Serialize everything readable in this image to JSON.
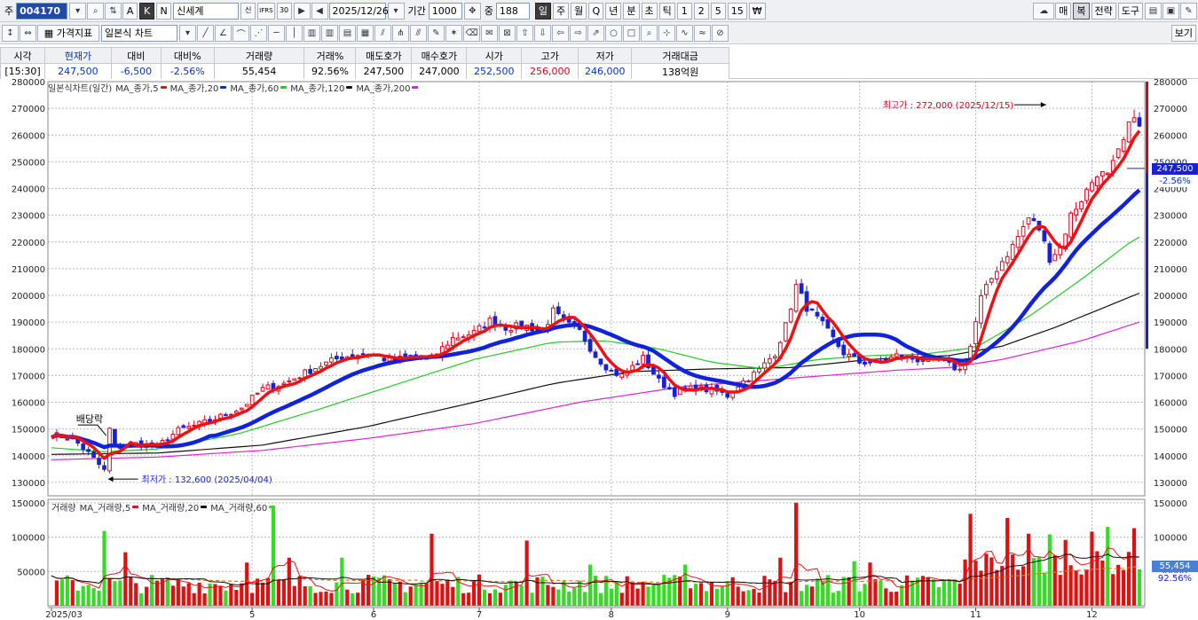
{
  "toolbar1": {
    "market_label": "주",
    "code": "004170",
    "btn_k_upper": "A",
    "btn_k": "K",
    "btn_n": "N",
    "stock_name": "신세계",
    "name_badges": [
      "신",
      "IFRS",
      "30"
    ],
    "date": "2025/12/26",
    "period_label": "기간",
    "period_value": "1000",
    "count_label": "중",
    "count_value": "188",
    "periods": [
      "일",
      "주",
      "월",
      "Q",
      "년",
      "분",
      "초",
      "틱",
      "1",
      "2",
      "5",
      "15",
      "₩"
    ],
    "active_period": "일",
    "right_buttons": [
      "매",
      "복",
      "전략",
      "도구"
    ]
  },
  "toolbar2": {
    "indicator_button": "가격지표",
    "chart_type": "일본식 차트",
    "view_button": "보기"
  },
  "quote": {
    "headers": [
      "시각",
      "현재가",
      "대비",
      "대비%",
      "거래량",
      "거래%",
      "매도호가",
      "매수호가",
      "시가",
      "고가",
      "저가",
      "거래대금"
    ],
    "values": [
      "[15:30]",
      "247,500",
      "-6,500",
      "-2.56%",
      "55,454",
      "92.56%",
      "247,500",
      "247,000",
      "252,500",
      "256,000",
      "246,000",
      "138억원"
    ]
  },
  "colors": {
    "up": "#e8001c",
    "down": "#1a20d8",
    "ma5": "#ee1111",
    "ma20": "#1122dd",
    "ma60": "#22cc22",
    "ma120": "#111111",
    "ma200": "#dd22dd",
    "vol_up": "#dd1111",
    "vol_down": "#33dd22"
  },
  "chart_data": [
    {
      "type": "candlestick",
      "title": "일본식차트(일간)",
      "legend": [
        "MA_종가,5",
        "MA_종가,20",
        "MA_종가,60",
        "MA_종가,120",
        "MA_종가,200"
      ],
      "ylim": [
        125000,
        280000
      ],
      "y_ticks": [
        130000,
        140000,
        150000,
        160000,
        170000,
        180000,
        190000,
        200000,
        210000,
        220000,
        230000,
        240000,
        250000,
        260000,
        270000,
        280000
      ],
      "y_tick_labels": [
        "130000",
        "140000",
        "150000",
        "160000",
        "170000",
        "180000",
        "190000",
        "200000",
        "210000",
        "220000",
        "230000",
        "240000",
        "250000",
        "260000",
        "270000",
        "280000"
      ],
      "x_labels": [
        "2025/03",
        "5",
        "6",
        "7",
        "8",
        "9",
        "10",
        "11",
        "12"
      ],
      "x_label_days": [
        0,
        38,
        61,
        81,
        106,
        128,
        153,
        175,
        197
      ],
      "total_days": 206,
      "annotations": {
        "high": {
          "text": "최고가 : 272,000 (2025/12/15)",
          "value": 272000,
          "day": 189
        },
        "low": {
          "text": "최저가 : 132,600 (2025/04/04)",
          "value": 132600,
          "day": 10
        },
        "dividend": {
          "text": "배당락",
          "day": 5
        }
      },
      "last_price": {
        "value": 247500,
        "label": "247,500",
        "pct": "-2.56%"
      },
      "anchors": [
        [
          0,
          148000
        ],
        [
          4,
          146500
        ],
        [
          7,
          141000
        ],
        [
          10,
          134500
        ],
        [
          11,
          150000
        ],
        [
          12,
          143000
        ],
        [
          16,
          144500
        ],
        [
          20,
          143500
        ],
        [
          24,
          149500
        ],
        [
          30,
          153000
        ],
        [
          36,
          158000
        ],
        [
          40,
          165000
        ],
        [
          44,
          167000
        ],
        [
          50,
          173000
        ],
        [
          55,
          177000
        ],
        [
          60,
          178500
        ],
        [
          64,
          175500
        ],
        [
          68,
          177000
        ],
        [
          72,
          176500
        ],
        [
          76,
          184000
        ],
        [
          80,
          186000
        ],
        [
          83,
          190500
        ],
        [
          86,
          188000
        ],
        [
          90,
          188500
        ],
        [
          93,
          186500
        ],
        [
          95,
          194000
        ],
        [
          97,
          190000
        ],
        [
          100,
          186500
        ],
        [
          103,
          177500
        ],
        [
          106,
          171500
        ],
        [
          108,
          170000
        ],
        [
          112,
          176500
        ],
        [
          115,
          168000
        ],
        [
          118,
          163500
        ],
        [
          122,
          165500
        ],
        [
          126,
          164000
        ],
        [
          128,
          162500
        ],
        [
          130,
          166500
        ],
        [
          134,
          172000
        ],
        [
          137,
          178500
        ],
        [
          139,
          188500
        ],
        [
          141,
          203500
        ],
        [
          143,
          195500
        ],
        [
          146,
          189000
        ],
        [
          150,
          178500
        ],
        [
          153,
          175000
        ],
        [
          157,
          175000
        ],
        [
          160,
          177500
        ],
        [
          164,
          176000
        ],
        [
          168,
          175500
        ],
        [
          171,
          173000
        ],
        [
          172,
          172000
        ],
        [
          174,
          181000
        ],
        [
          176,
          199000
        ],
        [
          179,
          210000
        ],
        [
          182,
          218500
        ],
        [
          185,
          229000
        ],
        [
          187,
          225000
        ],
        [
          189,
          214000
        ],
        [
          191,
          218000
        ],
        [
          193,
          230000
        ],
        [
          196,
          239000
        ],
        [
          198,
          246000
        ],
        [
          200,
          244500
        ],
        [
          203,
          257500
        ],
        [
          205,
          268500
        ],
        [
          207,
          256000
        ],
        [
          209,
          252000
        ],
        [
          211,
          250000
        ],
        [
          213,
          247500
        ]
      ],
      "ma_levels": {
        "ma60": [
          [
            0,
            143000
          ],
          [
            10,
            141500
          ],
          [
            20,
            142500
          ],
          [
            35,
            148000
          ],
          [
            50,
            157000
          ],
          [
            65,
            166500
          ],
          [
            80,
            176000
          ],
          [
            95,
            182500
          ],
          [
            105,
            183000
          ],
          [
            115,
            180000
          ],
          [
            125,
            175000
          ],
          [
            135,
            172500
          ],
          [
            145,
            176000
          ],
          [
            155,
            177500
          ],
          [
            165,
            178000
          ],
          [
            175,
            180500
          ],
          [
            185,
            192000
          ],
          [
            195,
            206000
          ],
          [
            205,
            221000
          ],
          [
            213,
            227500
          ]
        ],
        "ma120": [
          [
            0,
            140500
          ],
          [
            20,
            141000
          ],
          [
            40,
            144000
          ],
          [
            60,
            151000
          ],
          [
            80,
            160000
          ],
          [
            95,
            167000
          ],
          [
            110,
            171500
          ],
          [
            125,
            172500
          ],
          [
            140,
            173000
          ],
          [
            155,
            176000
          ],
          [
            170,
            177500
          ],
          [
            180,
            181000
          ],
          [
            190,
            188000
          ],
          [
            200,
            196000
          ],
          [
            213,
            206500
          ]
        ],
        "ma200": [
          [
            0,
            138500
          ],
          [
            20,
            139500
          ],
          [
            40,
            142000
          ],
          [
            60,
            146500
          ],
          [
            80,
            152000
          ],
          [
            100,
            160000
          ],
          [
            120,
            166000
          ],
          [
            140,
            169000
          ],
          [
            160,
            172000
          ],
          [
            170,
            173000
          ],
          [
            180,
            176000
          ],
          [
            195,
            183000
          ],
          [
            213,
            194500
          ]
        ]
      }
    },
    {
      "type": "bar",
      "title": "거래량",
      "legend": [
        "MA_거래량,5",
        "MA_거래량,20",
        "MA_거래량,60"
      ],
      "ylim": [
        0,
        155000
      ],
      "y_ticks": [
        50000,
        100000,
        150000
      ],
      "y_tick_labels": [
        "50000",
        "100000",
        "150000"
      ],
      "last_volume": {
        "value": 55454,
        "label": "55,454",
        "pct": "92.56%"
      },
      "spikes": [
        [
          10,
          109000
        ],
        [
          14,
          78000
        ],
        [
          37,
          63000
        ],
        [
          42,
          143000
        ],
        [
          45,
          70000
        ],
        [
          55,
          70000
        ],
        [
          72,
          105000
        ],
        [
          90,
          95000
        ],
        [
          102,
          60000
        ],
        [
          120,
          60000
        ],
        [
          138,
          70000
        ],
        [
          141,
          150000
        ],
        [
          152,
          65000
        ],
        [
          155,
          63000
        ],
        [
          174,
          134000
        ],
        [
          181,
          128000
        ],
        [
          185,
          105000
        ],
        [
          189,
          104000
        ],
        [
          192,
          96000
        ],
        [
          197,
          108000
        ],
        [
          200,
          115000
        ],
        [
          205,
          113000
        ],
        [
          207,
          118000
        ],
        [
          210,
          72000
        ]
      ]
    }
  ]
}
